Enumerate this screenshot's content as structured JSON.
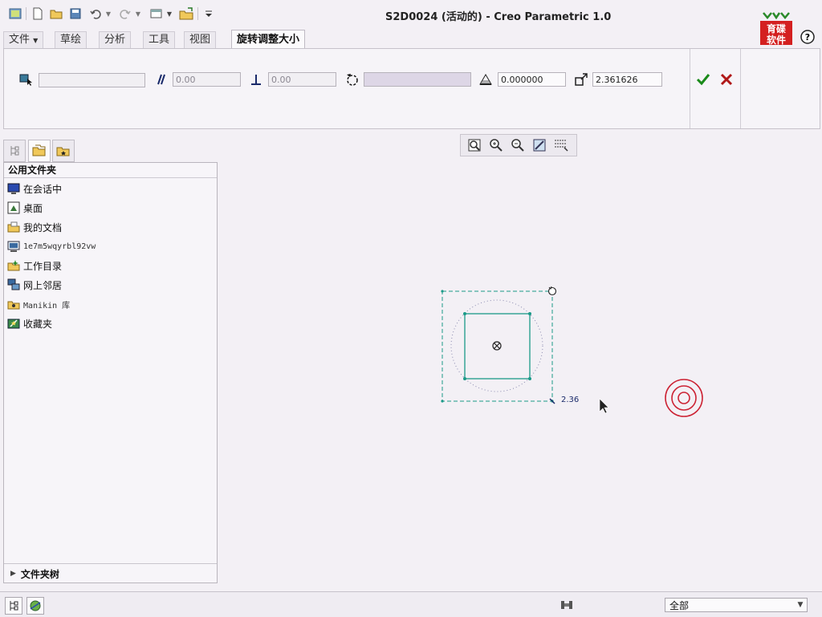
{
  "window": {
    "title": "S2D0024 (活动的) - Creo Parametric 1.0"
  },
  "quick_access": {
    "icons": [
      "app-window-icon",
      "new-file-icon",
      "open-folder-icon",
      "save-icon",
      "undo-icon",
      "redo-icon",
      "window-switch-icon",
      "close-window-icon",
      "customize-dropdown-icon"
    ]
  },
  "logo": {
    "text": "育碟软件"
  },
  "tabs": [
    {
      "label": "文件",
      "has_dropdown": true
    },
    {
      "label": "草绘"
    },
    {
      "label": "分析"
    },
    {
      "label": "工具"
    },
    {
      "label": "视图"
    },
    {
      "label": "旋转调整大小",
      "active": true
    }
  ],
  "dashboard": {
    "fields": {
      "translate": "",
      "horizontal": "0.00",
      "vertical": "0.00",
      "rotate": "",
      "angle": "0.000000",
      "scale": "2.361626"
    },
    "accept_color": "#1a8a1a",
    "cancel_color": "#b01818"
  },
  "navigator": {
    "header": "公用文件夹",
    "items": [
      {
        "label": "在会话中",
        "icon": "session-monitor-icon"
      },
      {
        "label": "桌面",
        "icon": "desktop-icon"
      },
      {
        "label": "我的文档",
        "icon": "my-documents-icon"
      },
      {
        "label": "1e7m5wqyrbl92vw",
        "icon": "computer-icon",
        "mono": true
      },
      {
        "label": "工作目录",
        "icon": "working-directory-icon"
      },
      {
        "label": "网上邻居",
        "icon": "network-icon"
      },
      {
        "label": "Manikin 库",
        "icon": "library-icon",
        "mono": true
      },
      {
        "label": "收藏夹",
        "icon": "favorites-icon"
      }
    ],
    "folder_tree": "文件夹树"
  },
  "canvas": {
    "scale_label": "2.36",
    "sketch_color": "#1b9a88",
    "target_color": "#cc2233"
  },
  "status": {
    "filter_value": "全部"
  }
}
